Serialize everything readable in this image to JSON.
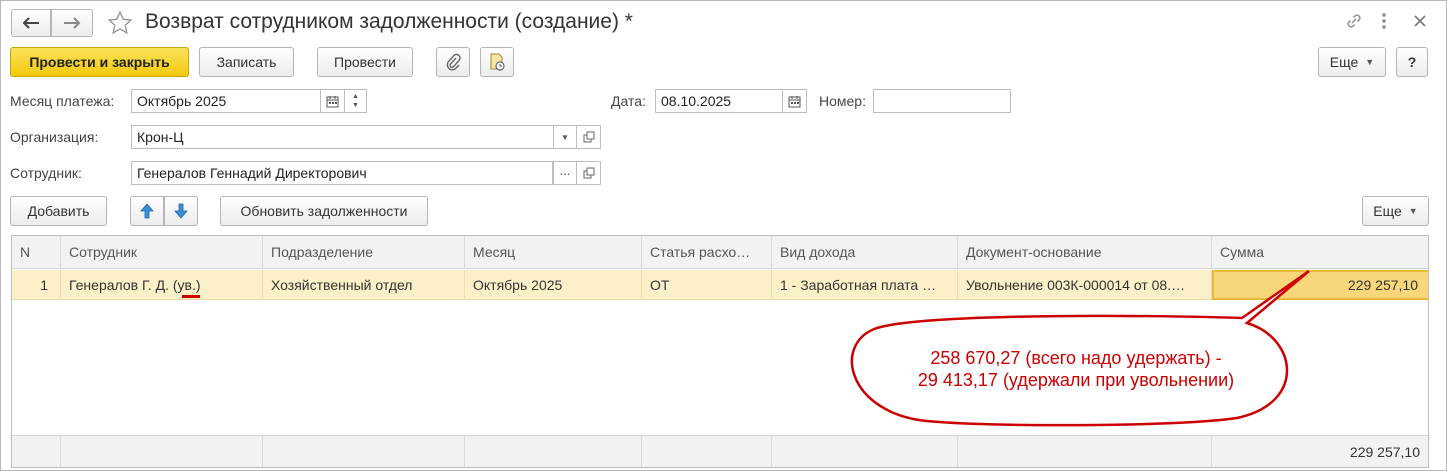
{
  "window": {
    "title": "Возврат сотрудником задолженности (создание) *"
  },
  "toolbar": {
    "post_close": "Провести и закрыть",
    "save": "Записать",
    "post": "Провести",
    "more": "Еще",
    "help": "?"
  },
  "form": {
    "month_label": "Месяц платежа:",
    "month_value": "Октябрь 2025",
    "date_label": "Дата:",
    "date_value": "08.10.2025",
    "number_label": "Номер:",
    "number_value": "",
    "org_label": "Организация:",
    "org_value": "Крон-Ц",
    "employee_label": "Сотрудник:",
    "employee_value": "Генералов Геннадий Директорович"
  },
  "table_toolbar": {
    "add": "Добавить",
    "refresh": "Обновить задолженности",
    "more": "Еще"
  },
  "table": {
    "columns": [
      "N",
      "Сотрудник",
      "Подразделение",
      "Месяц",
      "Статья расхо…",
      "Вид дохода",
      "Документ-основание",
      "Сумма"
    ],
    "rows": [
      {
        "n": "1",
        "employee": "Генералов Г. Д.",
        "employee_mark": "(ув.)",
        "department": "Хозяйственный отдел",
        "month": "Октябрь 2025",
        "expense_item": "ОТ",
        "income_type": "1 - Заработная плата …",
        "basis_doc": "Увольнение 003К-000014 от 08.…",
        "amount": "229 257,10"
      }
    ],
    "total": "229 257,10"
  },
  "callout": {
    "line1": "258 670,27 (всего надо удержать) -",
    "line2": "29 413,17 (удержали при увольнении)",
    "color": "#cc0000"
  }
}
